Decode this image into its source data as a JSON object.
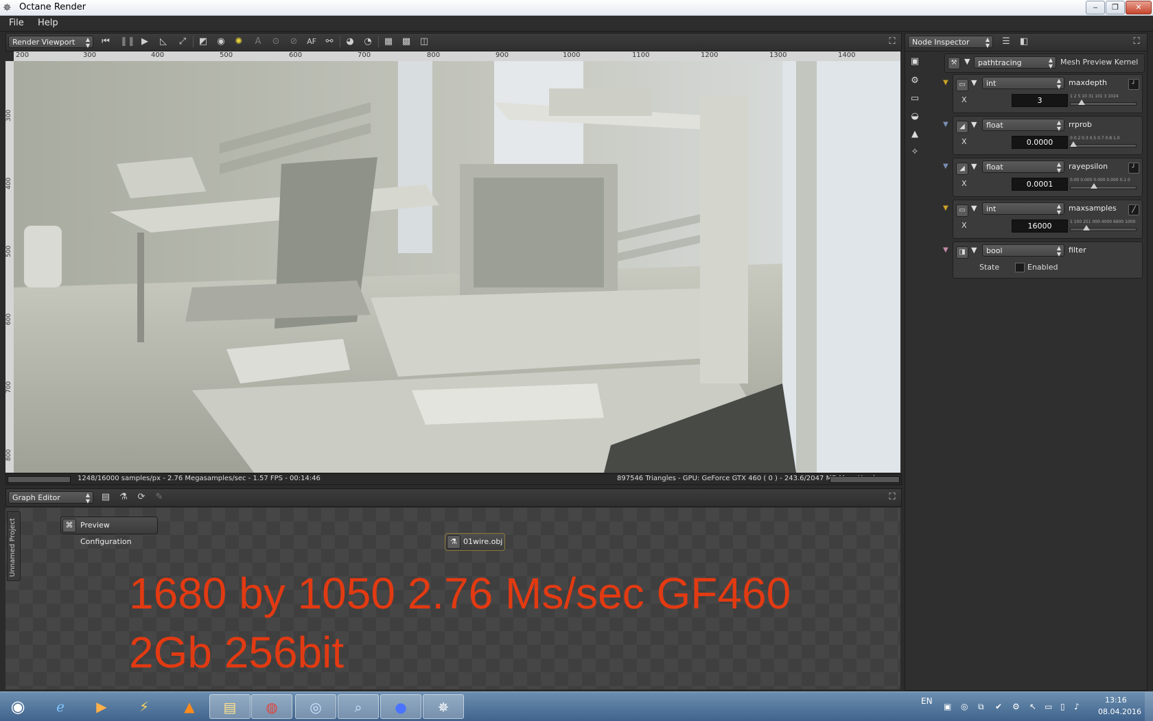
{
  "window": {
    "title": "Octane Render",
    "controls": [
      "‒",
      "❐",
      "✕"
    ]
  },
  "menu": [
    "File",
    "Help"
  ],
  "viewport": {
    "panel_label": "Render Viewport",
    "toolbar_af": "AF",
    "ruler_labels": [
      "200",
      "300",
      "400",
      "500",
      "600",
      "700",
      "800",
      "900",
      "1000",
      "1100",
      "1200",
      "1300",
      "1400"
    ],
    "vruler_labels": [
      "300",
      "400",
      "500",
      "600",
      "700",
      "800"
    ],
    "status_left": "1248/16000 samples/px - 2.76 Megasamples/sec - 1.57 FPS - 00:14:46",
    "status_right": "897546 Triangles - GPU: GeForce GTX 460 ( 0 ) - 243.6/2047 MB Mem Used"
  },
  "graph": {
    "panel_label": "Graph Editor",
    "side_tab": "Unnamed Project",
    "nodes": {
      "preview": "Preview Configuration",
      "mesh": "01wire.obj"
    },
    "overlay_line1": "1680 by 1050 2.76 Ms/sec  GF460",
    "overlay_line2": "2Gb 256bit"
  },
  "inspector": {
    "panel_label": "Node Inspector",
    "kernel_type": "pathtracing",
    "kernel_name": "Mesh Preview Kernel",
    "params": [
      {
        "type": "int",
        "name": "maxdepth",
        "axis": "X",
        "value": "3",
        "ticks": "1  2   5  10  31  101 3 1024",
        "fraction": 0.14,
        "pin_color": "#c9a227"
      },
      {
        "type": "float",
        "name": "rrprob",
        "axis": "X",
        "value": "0.0000",
        "ticks": "0 0.2  0.3  0.5  0.7  0.8 1.0",
        "fraction": 0.0,
        "pin_color": "#7a8fb4"
      },
      {
        "type": "float",
        "name": "rayepsilon",
        "axis": "X",
        "value": "0.0001",
        "ticks": "0.00 0.000 0.000 0.000 0.1 0",
        "fraction": 0.35,
        "pin_color": "#7a8fb4"
      },
      {
        "type": "int",
        "name": "maxsamples",
        "axis": "X",
        "value": "16000",
        "ticks": "1 100 251 000 4000 6900 10000",
        "fraction": 0.22,
        "pin_color": "#c9a227"
      }
    ],
    "filter": {
      "type": "bool",
      "name": "filter",
      "state_label": "State",
      "checkbox_label": "Enabled",
      "pin_color": "#c48aa8"
    }
  },
  "taskbar": {
    "language": "EN",
    "time": "13:16",
    "date": "08.04.2016",
    "apps": [
      "start-orb",
      "internet-explorer",
      "media-player",
      "winamp",
      "vlc",
      "file-explorer",
      "chrome",
      "qbittorrent",
      "search-tool",
      "blue-globe",
      "octane-render"
    ]
  }
}
